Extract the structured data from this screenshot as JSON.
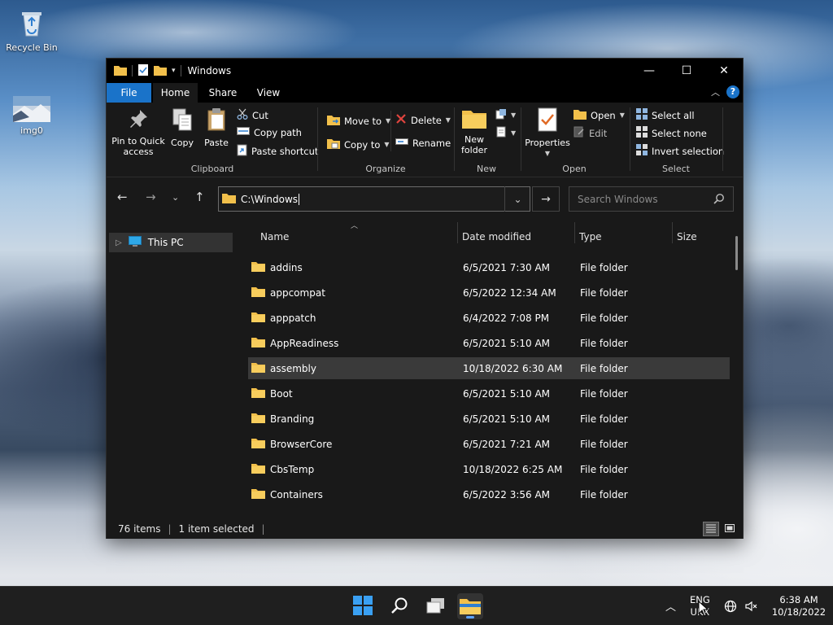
{
  "desktop": {
    "icons": [
      {
        "label": "Recycle Bin",
        "icon": "recycle-bin-icon"
      },
      {
        "label": "img0",
        "icon": "image-file-icon"
      }
    ]
  },
  "window": {
    "title": "Windows",
    "controls": {
      "minimize": "—",
      "maximize": "☐",
      "close": "✕"
    }
  },
  "ribbon": {
    "tabs": [
      {
        "label": "File",
        "active": false
      },
      {
        "label": "Home",
        "active": true
      },
      {
        "label": "Share",
        "active": false
      },
      {
        "label": "View",
        "active": false
      }
    ],
    "clipboard": {
      "group_label": "Clipboard",
      "pin_label_1": "Pin to Quick",
      "pin_label_2": "access",
      "copy_label": "Copy",
      "paste_label": "Paste",
      "cut_label": "Cut",
      "copy_path_label": "Copy path",
      "paste_shortcut_label": "Paste shortcut"
    },
    "organize": {
      "group_label": "Organize",
      "move_to_label": "Move to",
      "copy_to_label": "Copy to",
      "delete_label": "Delete",
      "rename_label": "Rename"
    },
    "new": {
      "group_label": "New",
      "new_folder_label_1": "New",
      "new_folder_label_2": "folder"
    },
    "open": {
      "group_label": "Open",
      "properties_label": "Properties",
      "open_label": "Open",
      "edit_label": "Edit"
    },
    "select": {
      "group_label": "Select",
      "select_all_label": "Select all",
      "select_none_label": "Select none",
      "invert_label": "Invert selection"
    }
  },
  "navigation": {
    "address": "C:\\Windows",
    "search_placeholder": "Search Windows"
  },
  "nav_pane": {
    "items": [
      {
        "label": "This PC",
        "icon": "this-pc-icon"
      }
    ]
  },
  "file_list": {
    "columns": [
      "Name",
      "Date modified",
      "Type",
      "Size"
    ],
    "rows": [
      {
        "name": "addins",
        "date": "6/5/2021 7:30 AM",
        "type": "File folder",
        "selected": false
      },
      {
        "name": "appcompat",
        "date": "6/5/2022 12:34 AM",
        "type": "File folder",
        "selected": false
      },
      {
        "name": "apppatch",
        "date": "6/4/2022 7:08 PM",
        "type": "File folder",
        "selected": false
      },
      {
        "name": "AppReadiness",
        "date": "6/5/2021 5:10 AM",
        "type": "File folder",
        "selected": false
      },
      {
        "name": "assembly",
        "date": "10/18/2022 6:30 AM",
        "type": "File folder",
        "selected": true
      },
      {
        "name": "Boot",
        "date": "6/5/2021 5:10 AM",
        "type": "File folder",
        "selected": false
      },
      {
        "name": "Branding",
        "date": "6/5/2021 5:10 AM",
        "type": "File folder",
        "selected": false
      },
      {
        "name": "BrowserCore",
        "date": "6/5/2021 7:21 AM",
        "type": "File folder",
        "selected": false
      },
      {
        "name": "CbsTemp",
        "date": "10/18/2022 6:25 AM",
        "type": "File folder",
        "selected": false
      },
      {
        "name": "Containers",
        "date": "6/5/2022 3:56 AM",
        "type": "File folder",
        "selected": false
      }
    ]
  },
  "status": {
    "item_count": "76 items",
    "selection": "1 item selected"
  },
  "taskbar": {
    "apps": [
      "start-icon",
      "search-icon",
      "task-view-icon",
      "file-explorer-icon"
    ],
    "language_line1": "ENG",
    "language_line2": "UKX",
    "time": "6:38 AM",
    "date": "10/18/2022"
  },
  "colors": {
    "accent": "#1a73c9",
    "folder": "#f2c04b",
    "window_bg": "#191919",
    "selection": "#3a3a3a"
  }
}
